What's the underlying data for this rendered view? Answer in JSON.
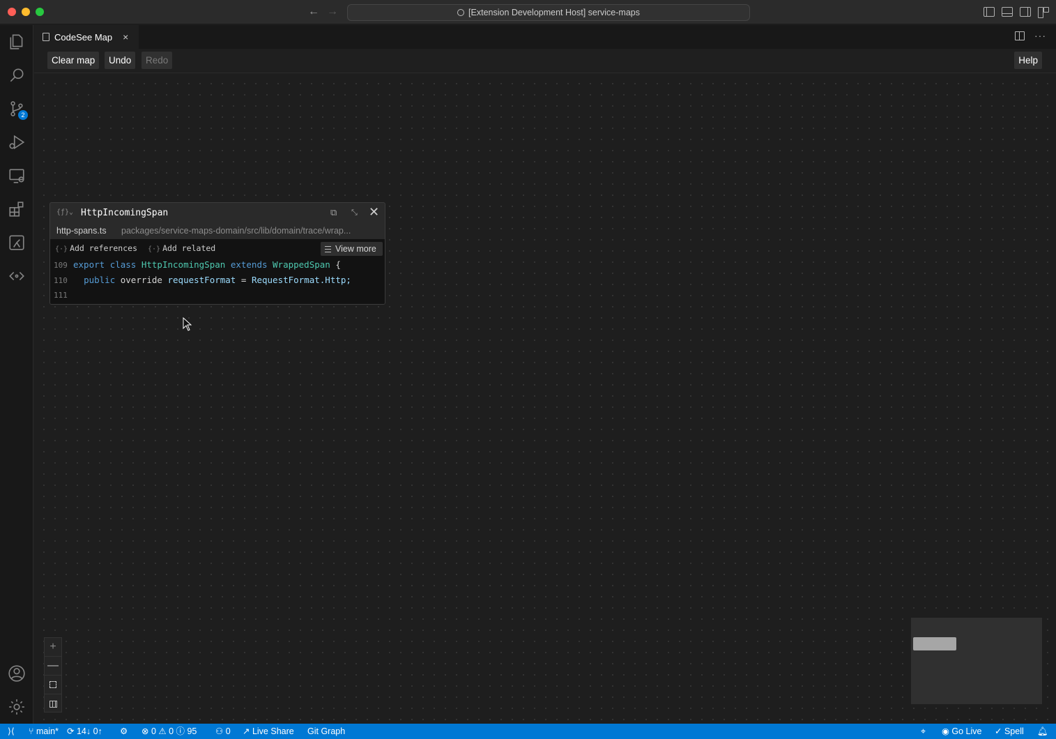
{
  "titlebar": {
    "title": "[Extension Development Host] service-maps",
    "icons": [
      "back-arrow-icon",
      "forward-arrow-icon",
      "search-icon",
      "toggle-primary-sidebar-icon",
      "toggle-panel-icon",
      "toggle-secondary-sidebar-icon",
      "customize-layout-icon"
    ]
  },
  "activity_bar": {
    "items": [
      "explorer-icon",
      "search-icon",
      "source-control-icon",
      "run-debug-icon",
      "remote-explorer-icon",
      "extensions-icon",
      "codesee-icon",
      "codesee-map-icon"
    ],
    "source_control_badge": "2",
    "bottom": [
      "accounts-icon",
      "manage-gear-icon"
    ]
  },
  "editor": {
    "tab": {
      "label": "CodeSee Map",
      "close": "×"
    }
  },
  "toolbar": {
    "clear": "Clear map",
    "undo": "Undo",
    "redo": "Redo",
    "help": "Help"
  },
  "node": {
    "symbol": "{ƒ}⌄",
    "title": "HttpIncomingSpan",
    "file": "http-spans.ts",
    "dir": "packages/service-maps-domain/src/lib/domain/trace/wrap...",
    "add_references": "Add references",
    "add_related": "Add related",
    "view_more": "View more",
    "lines": [
      {
        "num": "109",
        "tokens": [
          "export",
          "class",
          "HttpIncomingSpan",
          "extends",
          "WrappedSpan",
          "{"
        ]
      },
      {
        "num": "110",
        "tokens": [
          "public",
          "override",
          "requestFormat",
          "=",
          "RequestFormat.Http;"
        ]
      },
      {
        "num": "111",
        "tokens": []
      }
    ]
  },
  "zoom": {
    "in": "+",
    "out": "—"
  },
  "colors": {
    "statusbar": "#0078d4",
    "canvas": "#1e1e1e",
    "keyword": "#569cd6",
    "type": "#4ec9b0"
  },
  "statusbar": {
    "branch": "main*",
    "sync": "14↓ 0↑",
    "errors": "0",
    "warnings": "0",
    "infos": "95",
    "ports": "0",
    "live_share": "Live Share",
    "git_graph": "Git Graph",
    "go_live": "Go Live",
    "spell": "Spell"
  }
}
